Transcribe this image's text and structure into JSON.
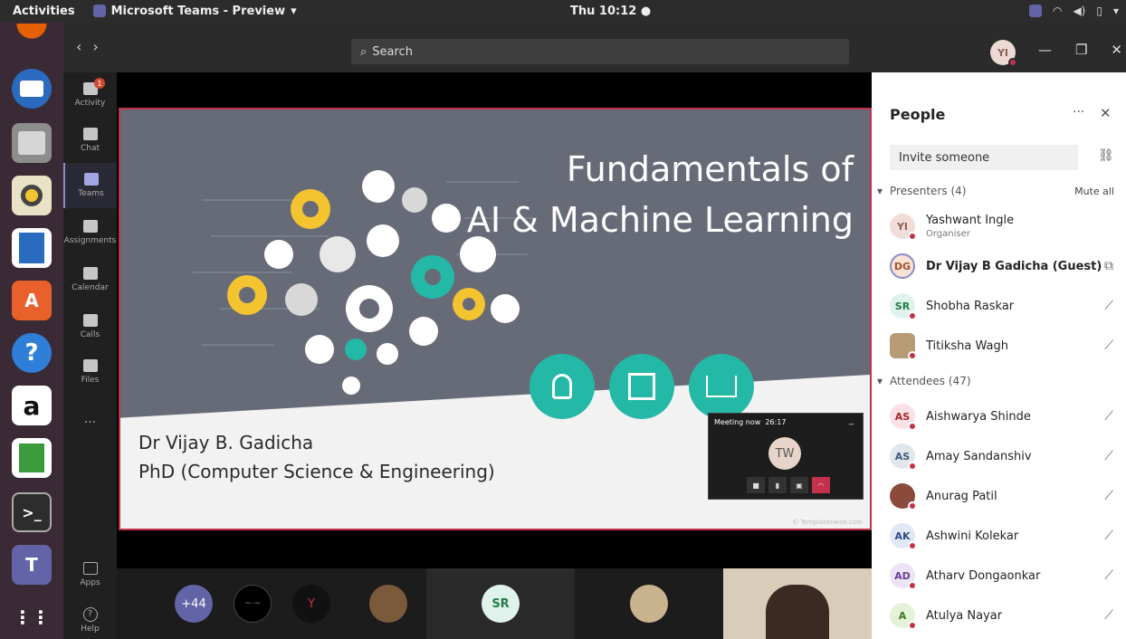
{
  "topbar": {
    "activities": "Activities",
    "app_name": "Microsoft Teams - Preview",
    "clock": "Thu 10:12"
  },
  "dock": {
    "items": [
      "firefox",
      "thunderbird",
      "files",
      "rhythmbox",
      "writer",
      "software-center",
      "help",
      "amazon",
      "calc",
      "terminal",
      "teams",
      "show-apps"
    ]
  },
  "rail": {
    "activity": "Activity",
    "activity_badge": "1",
    "chat": "Chat",
    "teams": "Teams",
    "assignments": "Assignments",
    "calendar": "Calendar",
    "calls": "Calls",
    "files": "Files",
    "more": "...",
    "apps": "Apps",
    "help": "Help"
  },
  "header": {
    "search_placeholder": "Search",
    "me_initials": "YI"
  },
  "slide": {
    "title_line1": "Fundamentals of",
    "title_line2": "AI & Machine Learning",
    "presenter": "Dr Vijay B. Gadicha",
    "degree": "PhD (Computer Science & Engineering)",
    "copyright": "© Templateswise.com"
  },
  "mini_meeting": {
    "label": "Meeting now",
    "time": "26:17",
    "minimize": "_",
    "initials": "TW"
  },
  "strip": {
    "overflow": "+44",
    "sr_initials": "SR"
  },
  "people": {
    "title": "People",
    "invite_placeholder": "Invite someone",
    "presenters_label": "Presenters (4)",
    "mute_all": "Mute all",
    "attendees_label": "Attendees (47)",
    "presenters": [
      {
        "initials": "YI",
        "name": "Yashwant Ingle",
        "role": "Organiser"
      },
      {
        "initials": "DG",
        "name": "Dr Vijay B Gadicha (Guest)",
        "role": ""
      },
      {
        "initials": "SR",
        "name": "Shobha Raskar",
        "role": ""
      },
      {
        "initials": "",
        "name": "Titiksha Wagh",
        "role": ""
      }
    ],
    "attendees": [
      {
        "initials": "AS",
        "name": "Aishwarya Shinde"
      },
      {
        "initials": "AS",
        "name": "Amay Sandanshiv"
      },
      {
        "initials": "",
        "name": "Anurag Patil"
      },
      {
        "initials": "AK",
        "name": "Ashwini Kolekar"
      },
      {
        "initials": "AD",
        "name": "Atharv Dongaonkar"
      },
      {
        "initials": "A",
        "name": "Atulya Nayar"
      }
    ]
  }
}
